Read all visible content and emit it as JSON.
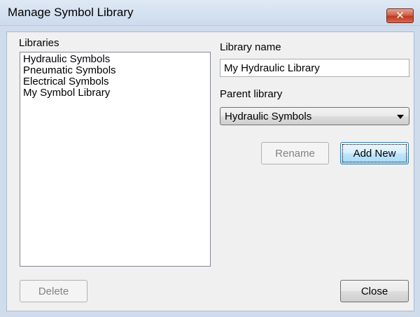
{
  "window": {
    "title": "Manage Symbol Library",
    "close_glyph": "✕"
  },
  "libraries": {
    "label": "Libraries",
    "items": [
      {
        "label": "Hydraulic Symbols"
      },
      {
        "label": "Pneumatic Symbols"
      },
      {
        "label": "Electrical Symbols"
      },
      {
        "label": "My Symbol Library"
      }
    ]
  },
  "library_name": {
    "label": "Library name",
    "value": "My Hydraulic Library"
  },
  "parent_library": {
    "label": "Parent library",
    "selected": "Hydraulic Symbols"
  },
  "buttons": {
    "rename": "Rename",
    "add_new": "Add New",
    "delete": "Delete",
    "close": "Close"
  },
  "icons": {
    "close": "close-icon",
    "dropdown": "chevron-down-icon"
  }
}
